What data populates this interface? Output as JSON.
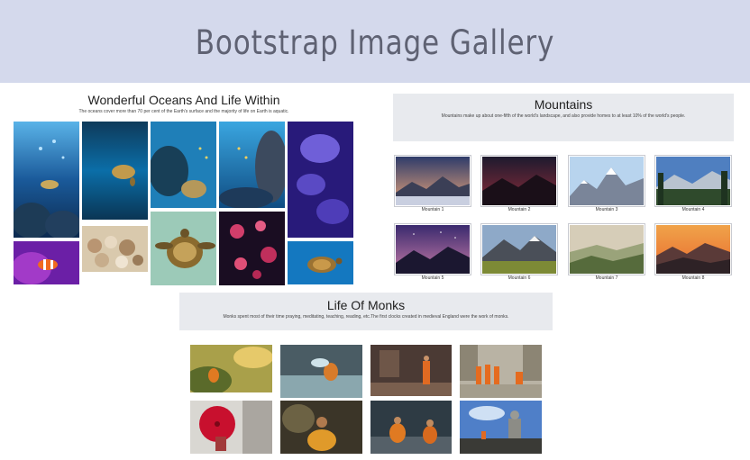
{
  "header": {
    "title": "Bootstrap Image Gallery"
  },
  "oceans": {
    "title": "Wonderful Oceans And Life Within",
    "description": "The oceans cover more than 70 per cent of the Earth's surface and the majority of life on Earth is aquatic."
  },
  "mountains": {
    "title": "Mountains",
    "description": "Mountains make up about one-fifth of the world's landscape, and also provide homes to at least 10% of the world's people.",
    "captions": [
      "Mountain 1",
      "Mountain 2",
      "Mountain 3",
      "Mountain 4",
      "Mountain 5",
      "Mountain 6",
      "Mountain 7",
      "Mountain 8"
    ]
  },
  "monks": {
    "title": "Life Of Monks",
    "description": "Monks spent most of their time praying, meditating, teaching, reading, etc.The first clocks created in medieval England were the work of monks."
  }
}
